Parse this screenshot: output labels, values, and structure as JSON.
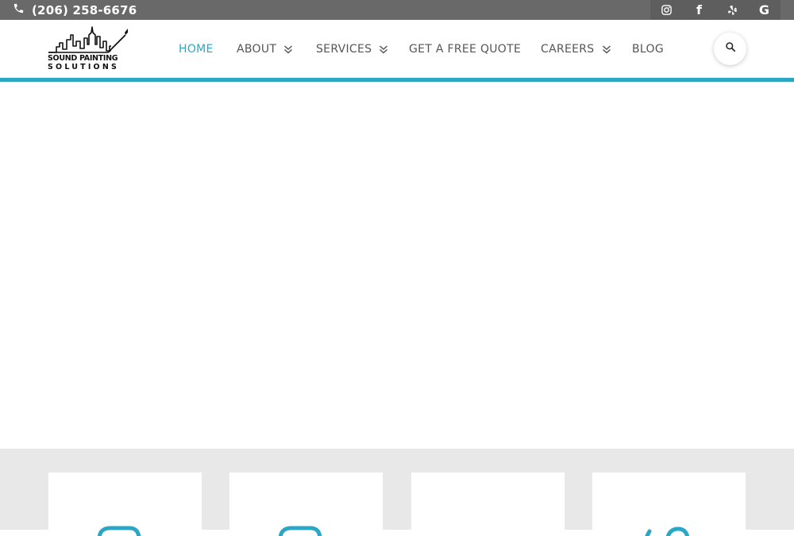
{
  "topbar": {
    "phone": "(206) 258-6676",
    "icons": [
      "phone-icon"
    ],
    "social": [
      {
        "name": "instagram-icon"
      },
      {
        "name": "facebook-icon",
        "glyph": "f"
      },
      {
        "name": "yelp-icon"
      },
      {
        "name": "google-icon",
        "glyph": "G"
      }
    ]
  },
  "logo": {
    "line1": "SOUND PAINTING",
    "line2": "SOLUTIONS"
  },
  "nav": {
    "items": [
      {
        "label": "HOME",
        "active": true
      },
      {
        "label": "ABOUT",
        "dropdown": true
      },
      {
        "label": "SERVICES",
        "dropdown": true
      },
      {
        "label": "GET A FREE QUOTE"
      },
      {
        "label": "CAREERS",
        "dropdown": true
      },
      {
        "label": "BLOG"
      }
    ]
  },
  "colors": {
    "accent": "#2aa7c5",
    "topbar": "#696969",
    "features_bg": "#e8e8e8"
  }
}
